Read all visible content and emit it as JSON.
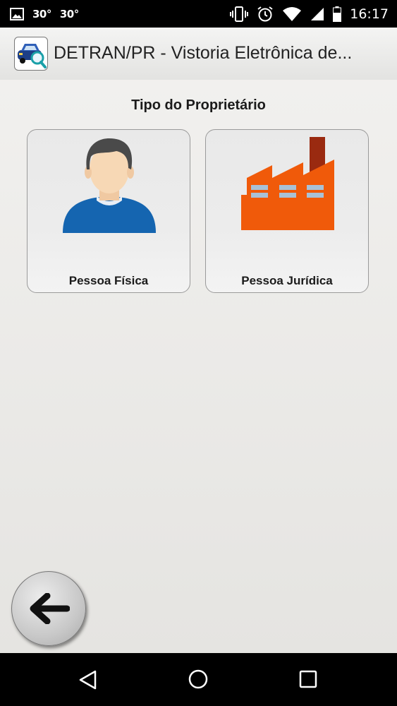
{
  "status_bar": {
    "temp1": "30°",
    "temp2": "30°",
    "time": "16:17",
    "icons": [
      "image-icon",
      "vibrate-icon",
      "alarm-icon",
      "wifi-icon",
      "signal-icon",
      "battery-icon"
    ]
  },
  "app_bar": {
    "title": "DETRAN/PR - Vistoria Eletrônica de...",
    "logo_icon": "car-search-logo-icon"
  },
  "main": {
    "section_title": "Tipo do Proprietário",
    "options": [
      {
        "label": "Pessoa Física",
        "icon": "person-icon"
      },
      {
        "label": "Pessoa Jurídica",
        "icon": "factory-icon"
      }
    ],
    "back_icon": "arrow-left-icon"
  },
  "nav_bar": {
    "icons": [
      "back-triangle-icon",
      "home-circle-icon",
      "recents-square-icon"
    ]
  },
  "colors": {
    "person_shirt": "#1565b0",
    "person_skin": "#f7d8b5",
    "person_hair": "#4a4a4a",
    "factory": "#f05a0a",
    "factory_chimney": "#9a2a10",
    "factory_windows": "#a9c1d6"
  }
}
